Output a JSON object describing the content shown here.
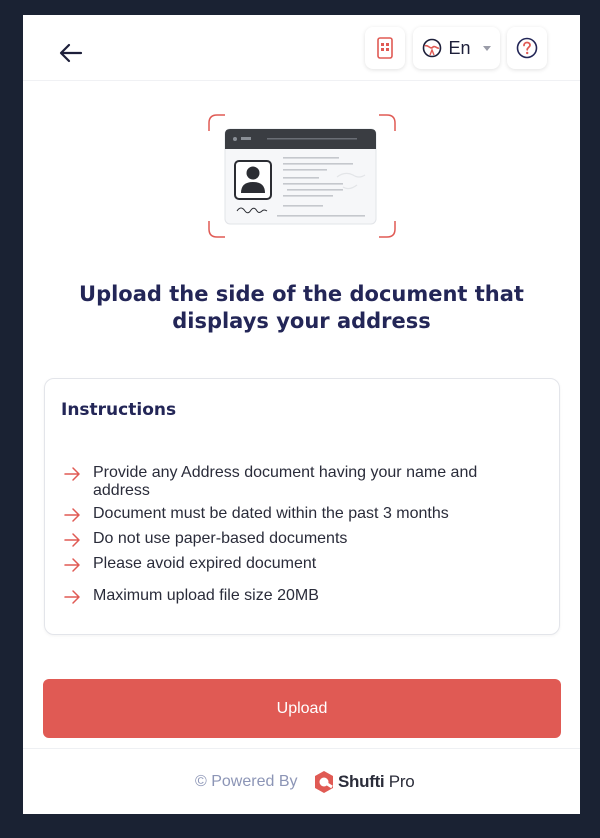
{
  "header": {
    "language": "En",
    "icons": {
      "back": "arrow-left-icon",
      "qr": "qr-phone-icon",
      "globe": "globe-icon",
      "help": "question-circle-icon"
    }
  },
  "main": {
    "title": "Upload the side of the document that displays your address"
  },
  "instructions": {
    "title": "Instructions",
    "items": [
      "Provide any Address document having your name and address",
      "Document must be dated within the past 3 months",
      "Do not use paper-based documents",
      "Please avoid expired document",
      "Maximum upload file size 20MB"
    ]
  },
  "actions": {
    "upload_label": "Upload"
  },
  "footer": {
    "powered_by": "© Powered By",
    "brand_name": "Shufti",
    "brand_suffix": "Pro"
  },
  "colors": {
    "accent": "#e05a54",
    "title": "#232657",
    "background": "#1a2233"
  }
}
